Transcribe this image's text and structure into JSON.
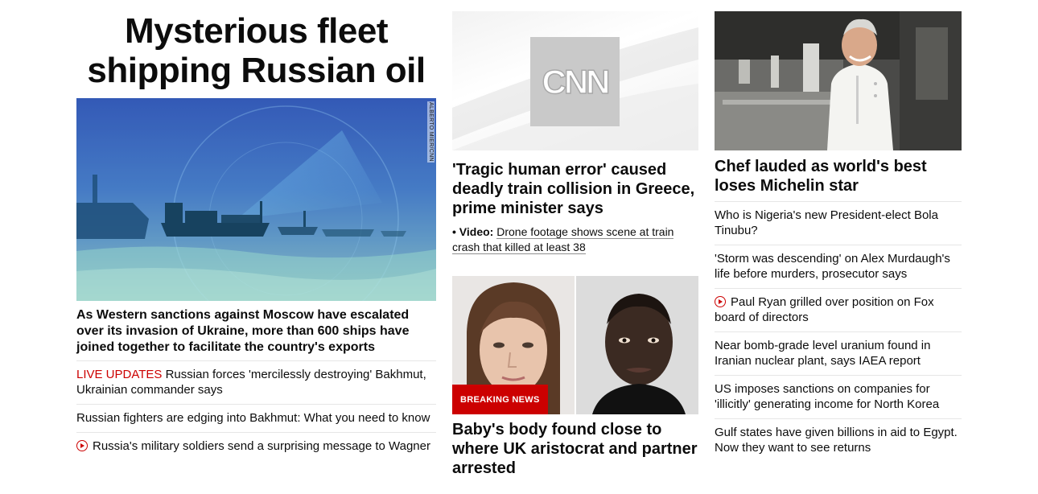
{
  "lead": {
    "title": "Mysterious fleet shipping Russian oil",
    "image_credit": "ALBERTO MIER/CNN",
    "description": "As Western sanctions against Moscow have escalated over its invasion of Ukraine, more than 600 ships have joined together to facilitate the country's exports",
    "links": [
      {
        "label": "LIVE UPDATES",
        "text": "Russian forces 'mercilessly destroying' Bakhmut, Ukrainian commander says"
      },
      {
        "text": "Russian fighters are edging into Bakhmut: What you need to know"
      },
      {
        "icon": "play-icon",
        "text": "Russia's military soldiers send a surprising message to Wagner"
      }
    ]
  },
  "middle": {
    "logo_text": "CNN",
    "story1": {
      "title": "'Tragic human error' caused deadly train collision in Greece, prime minister says",
      "video_label": "• Video:",
      "video_text": "Drone footage shows scene at train crash that killed at least 38"
    },
    "story2": {
      "badge": "BREAKING NEWS",
      "title": "Baby's body found close to where UK aristocrat and partner arrested"
    }
  },
  "right": {
    "title": "Chef lauded as world's best loses Michelin star",
    "links": [
      {
        "text": "Who is Nigeria's new President-elect Bola Tinubu?"
      },
      {
        "text": "'Storm was descending' on Alex Murdaugh's life before murders, prosecutor says"
      },
      {
        "icon": "play-icon",
        "text": "Paul Ryan grilled over position on Fox board of directors"
      },
      {
        "text": "Near bomb-grade level uranium found in Iranian nuclear plant, says IAEA report"
      },
      {
        "text": "US imposes sanctions on companies for 'illicitly' generating income for North Korea"
      },
      {
        "text": "Gulf states have given billions in aid to Egypt. Now they want to see returns"
      }
    ]
  },
  "colors": {
    "accent": "#cc0000",
    "divider": "#e6e6e6",
    "text": "#0c0c0c"
  }
}
